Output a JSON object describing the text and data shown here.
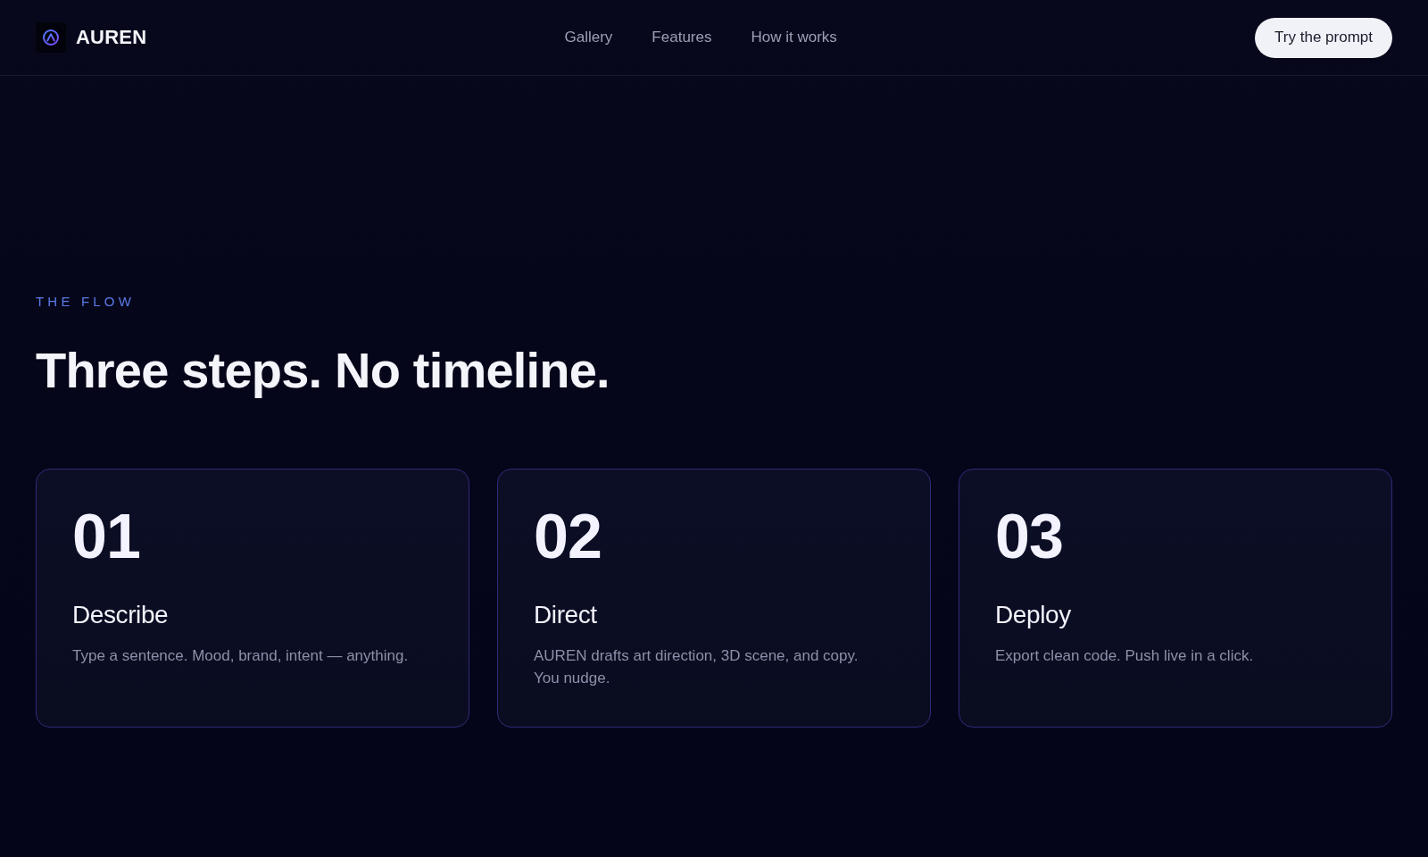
{
  "brand": {
    "name": "AUREN"
  },
  "nav": {
    "links": [
      "Gallery",
      "Features",
      "How it works"
    ],
    "cta": "Try the prompt"
  },
  "section": {
    "eyebrow": "THE FLOW",
    "heading": "Three steps. No timeline.",
    "steps": [
      {
        "number": "01",
        "title": "Describe",
        "description": "Type a sentence. Mood, brand, intent — anything."
      },
      {
        "number": "02",
        "title": "Direct",
        "description": "AUREN drafts art direction, 3D scene, and copy. You nudge."
      },
      {
        "number": "03",
        "title": "Deploy",
        "description": "Export clean code. Push live in a click."
      }
    ]
  }
}
